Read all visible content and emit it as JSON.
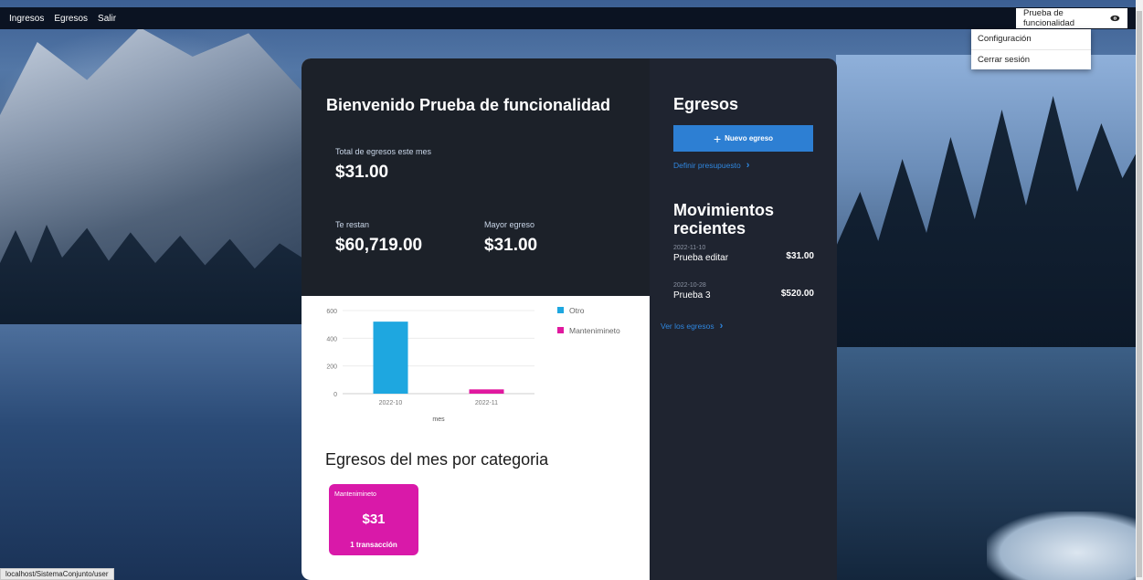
{
  "nav": {
    "items": [
      "Ingresos",
      "Egresos",
      "Salir"
    ],
    "user_label": "Prueba de funcionalidad",
    "user_icon": "eye-icon"
  },
  "dropdown": {
    "items": [
      "Configuración",
      "Cerrar sesión"
    ]
  },
  "summary": {
    "welcome": "Bienvenido Prueba de funcionalidad",
    "total_label": "Total de egresos este mes",
    "total_value": "$31.00",
    "remaining_label": "Te restan",
    "remaining_value": "$60,719.00",
    "max_label": "Mayor egreso",
    "max_value": "$31.00"
  },
  "chart_data": {
    "type": "bar",
    "categories": [
      "2022-10",
      "2022-11"
    ],
    "series": [
      {
        "name": "Otro",
        "values": [
          520,
          0
        ],
        "color": "#1ea7e0"
      },
      {
        "name": "Mantenimineto",
        "values": [
          0,
          31
        ],
        "color": "#e0199f"
      }
    ],
    "xlabel": "mes",
    "ylabel": "",
    "ylim": [
      0,
      600
    ],
    "yticks": [
      0,
      200,
      400,
      600
    ],
    "legend": "right"
  },
  "categories": {
    "heading": "Egresos del mes por categoria",
    "cards": [
      {
        "name": "Mantenimineto",
        "amount": "$31",
        "count": "1 transacción",
        "color": "#d919a9"
      }
    ]
  },
  "egresos": {
    "heading": "Egresos",
    "new_button": "Nuevo egreso",
    "budget_link": "Definir presupuesto",
    "recent_heading": "Movimientos recientes",
    "recent": [
      {
        "date": "2022-11-10",
        "name": "Prueba editar",
        "amount": "$31.00"
      },
      {
        "date": "2022-10-28",
        "name": "Prueba 3",
        "amount": "$520.00"
      }
    ],
    "view_all_link": "Ver los egresos"
  },
  "status_url": "localhost/SistemaConjunto/user"
}
